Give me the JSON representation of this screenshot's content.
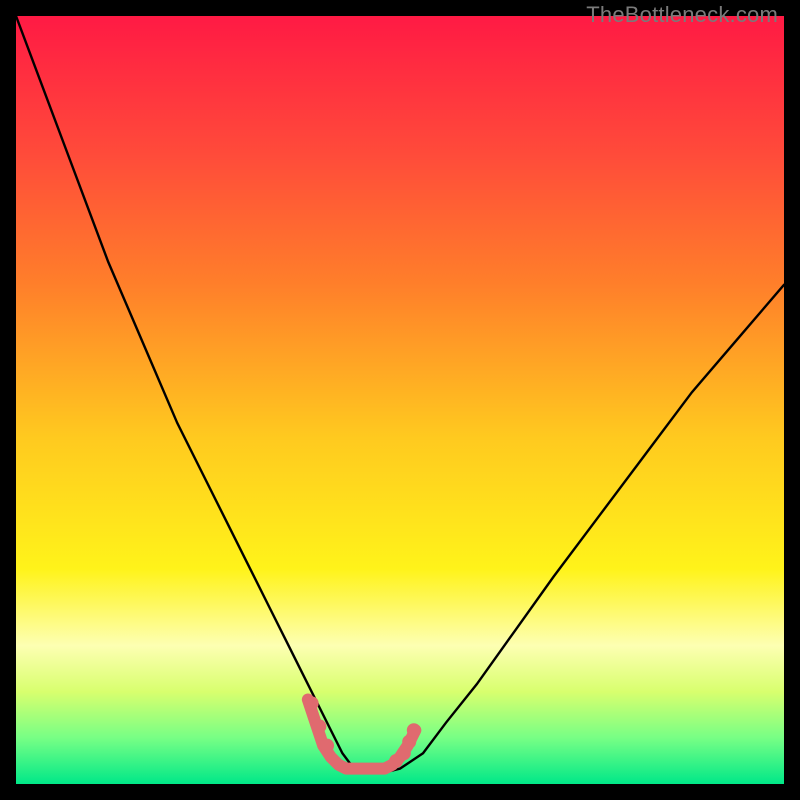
{
  "watermark": "TheBottleneck.com",
  "chart_data": {
    "type": "line",
    "title": "",
    "xlabel": "",
    "ylabel": "",
    "xlim": [
      0,
      100
    ],
    "ylim": [
      0,
      100
    ],
    "gradient_stops": [
      {
        "offset": 0.0,
        "color": "#ff1a44"
      },
      {
        "offset": 0.18,
        "color": "#ff4b3a"
      },
      {
        "offset": 0.35,
        "color": "#ff7f2a"
      },
      {
        "offset": 0.55,
        "color": "#ffca1f"
      },
      {
        "offset": 0.72,
        "color": "#fff31a"
      },
      {
        "offset": 0.82,
        "color": "#fdffb2"
      },
      {
        "offset": 0.88,
        "color": "#d8ff6e"
      },
      {
        "offset": 0.94,
        "color": "#77ff85"
      },
      {
        "offset": 1.0,
        "color": "#00e888"
      }
    ],
    "series": [
      {
        "name": "bottleneck-curve",
        "color": "#000000",
        "x": [
          0,
          3,
          6,
          9,
          12,
          15,
          18,
          21,
          24,
          27,
          30,
          33,
          35,
          37,
          39,
          41,
          42.5,
          44,
          46,
          48,
          50,
          53,
          56,
          60,
          65,
          70,
          76,
          82,
          88,
          94,
          100
        ],
        "y": [
          100,
          92,
          84,
          76,
          68,
          61,
          54,
          47,
          41,
          35,
          29,
          23,
          19,
          15,
          11,
          7,
          4,
          2,
          1.5,
          1.5,
          2,
          4,
          8,
          13,
          20,
          27,
          35,
          43,
          51,
          58,
          65
        ]
      },
      {
        "name": "marker-band",
        "color": "#e06a6f",
        "x": [
          38,
          39,
          40,
          41,
          42,
          43,
          44,
          45,
          46,
          47,
          48,
          49,
          50,
          51,
          52
        ],
        "y": [
          11,
          8,
          5,
          3.5,
          2.5,
          2,
          2,
          2,
          2,
          2,
          2,
          2.5,
          3.5,
          5,
          7
        ]
      }
    ],
    "markers": {
      "name": "marker-dots",
      "color": "#e06a6f",
      "points": [
        {
          "x": 38.5,
          "y": 10.5
        },
        {
          "x": 39.5,
          "y": 7.5
        },
        {
          "x": 40.5,
          "y": 5.0
        },
        {
          "x": 49.5,
          "y": 3.0
        },
        {
          "x": 50.5,
          "y": 4.0
        },
        {
          "x": 51.2,
          "y": 5.5
        },
        {
          "x": 51.8,
          "y": 7.0
        }
      ]
    }
  }
}
